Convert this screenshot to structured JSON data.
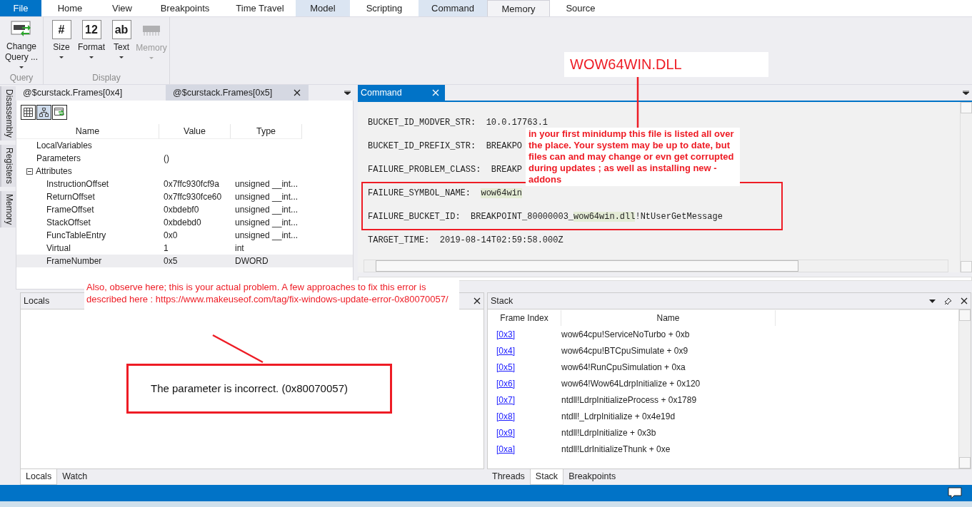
{
  "ribbon_tabs": [
    {
      "label": "File",
      "kind": "file",
      "selected": false
    },
    {
      "label": "Home",
      "kind": "normal",
      "selected": false
    },
    {
      "label": "View",
      "kind": "normal",
      "selected": false
    },
    {
      "label": "Breakpoints",
      "kind": "normal",
      "selected": false
    },
    {
      "label": "Time Travel",
      "kind": "normal",
      "selected": false
    },
    {
      "label": "Model",
      "kind": "contextual",
      "selected": false
    },
    {
      "label": "Scripting",
      "kind": "normal",
      "selected": false
    },
    {
      "label": "Command",
      "kind": "contextual",
      "selected": false
    },
    {
      "label": "Memory",
      "kind": "normal",
      "selected": true
    },
    {
      "label": "Source",
      "kind": "normal",
      "selected": false
    }
  ],
  "ribbon_groups": [
    {
      "label": "Query",
      "buttons": [
        {
          "kind": "chip-swap",
          "label": "Change Query ...",
          "disabled": false
        }
      ]
    },
    {
      "label": "Display",
      "buttons": [
        {
          "kind": "glyph",
          "glyph": "#",
          "label": "Size",
          "disabled": false
        },
        {
          "kind": "glyph",
          "glyph": "12",
          "label": "Format",
          "disabled": false
        },
        {
          "kind": "glyph",
          "glyph": "ab",
          "label": "Text",
          "disabled": false
        },
        {
          "kind": "chip",
          "label": "Memory",
          "disabled": true
        }
      ]
    }
  ],
  "side_tabs": [
    "Disassembly",
    "Registers",
    "Memory"
  ],
  "model_panel": {
    "tabs": [
      {
        "label": "@$curstack.Frames[0x4]",
        "selected": false
      },
      {
        "label": "@$curstack.Frames[0x5]",
        "selected": true
      }
    ],
    "view_buttons": [
      {
        "kind": "grid",
        "selected": false
      },
      {
        "kind": "tree",
        "selected": true
      },
      {
        "kind": "refresh",
        "selected": false
      }
    ],
    "columns": [
      "Name",
      "Value",
      "Type"
    ],
    "rows": [
      {
        "name": "LocalVariables",
        "value": "",
        "type": "",
        "selected": false
      },
      {
        "name": "Parameters",
        "value": "()",
        "type": "",
        "selected": false
      },
      {
        "name": "Attributes",
        "value": "",
        "type": "",
        "selected": false,
        "expanded": true,
        "children": [
          {
            "name": "InstructionOffset",
            "value": "0x7ffc930fcf9a",
            "type": "unsigned __int...",
            "selected": false
          },
          {
            "name": "ReturnOffset",
            "value": "0x7ffc930fce60",
            "type": "unsigned __int...",
            "selected": false
          },
          {
            "name": "FrameOffset",
            "value": "0xbdebf0",
            "type": "unsigned __int...",
            "selected": false
          },
          {
            "name": "StackOffset",
            "value": "0xbdebd0",
            "type": "unsigned __int...",
            "selected": false
          },
          {
            "name": "FuncTableEntry",
            "value": "0x0",
            "type": "unsigned __int...",
            "selected": false
          },
          {
            "name": "Virtual",
            "value": "1",
            "type": "int",
            "selected": false
          },
          {
            "name": "FrameNumber",
            "value": "0x5",
            "type": "DWORD",
            "selected": true
          }
        ]
      }
    ]
  },
  "command": {
    "title": "Command",
    "lines": [
      [
        {
          "text": "BUCKET_ID_MODVER_STR:  10.0.17763.1",
          "highlighted": false
        }
      ],
      [
        {
          "text": "BUCKET_ID_PREFIX_STR:  BREAKPO",
          "highlighted": false
        }
      ],
      [
        {
          "text": "FAILURE_PROBLEM_CLASS:  BREAKP",
          "highlighted": false
        }
      ],
      [
        {
          "text": "FAILURE_SYMBOL_NAME:  ",
          "highlighted": false
        },
        {
          "text": "wow64win",
          "highlighted": true
        }
      ],
      [
        {
          "text": "FAILURE_BUCKET_ID:  BREAKPOINT_80000003_",
          "highlighted": false
        },
        {
          "text": "wow64win.dll",
          "highlighted": true
        },
        {
          "text": "!NtUserGetMessage",
          "highlighted": false
        }
      ],
      [
        {
          "text": "TARGET_TIME:  2019-08-14T02:59:58.000Z",
          "highlighted": false
        }
      ]
    ]
  },
  "locals": {
    "title": "Locals",
    "tabs": [
      {
        "label": "Locals",
        "selected": true
      },
      {
        "label": "Watch",
        "selected": false
      }
    ]
  },
  "stack": {
    "title": "Stack",
    "columns": [
      "Frame Index",
      "Name"
    ],
    "rows": [
      {
        "index": "[0x3]",
        "name": "wow64cpu!ServiceNoTurbo + 0xb"
      },
      {
        "index": "[0x4]",
        "name": "wow64cpu!BTCpuSimulate + 0x9"
      },
      {
        "index": "[0x5]",
        "name": "wow64!RunCpuSimulation + 0xa"
      },
      {
        "index": "[0x6]",
        "name": "wow64!Wow64LdrpInitialize + 0x120"
      },
      {
        "index": "[0x7]",
        "name": "ntdll!LdrpInitializeProcess + 0x1789"
      },
      {
        "index": "[0x8]",
        "name": "ntdll!_LdrpInitialize + 0x4e19d"
      },
      {
        "index": "[0x9]",
        "name": "ntdll!LdrpInitialize + 0x3b"
      },
      {
        "index": "[0xa]",
        "name": "ntdll!LdrInitializeThunk + 0xe"
      }
    ],
    "tabs": [
      {
        "label": "Threads",
        "selected": false
      },
      {
        "label": "Stack",
        "selected": true
      },
      {
        "label": "Breakpoints",
        "selected": false
      }
    ]
  },
  "annotations": [
    {
      "kind": "label",
      "text": "WOW64WIN.DLL"
    },
    {
      "kind": "note",
      "text": "in your first minidump this file is listed all over the place. Your system may be up to date, but files can and may change or evn get corrupted during updates ; as well as installing new - addons"
    },
    {
      "kind": "note",
      "text": "Also, observe here; this is your actual problem. A few approaches to fix this error is described here : https://www.makeuseof.com/tag/fix-windows-update-error-0x80070057/"
    },
    {
      "kind": "callout",
      "text": "The parameter is incorrect. (0x80070057)"
    }
  ]
}
